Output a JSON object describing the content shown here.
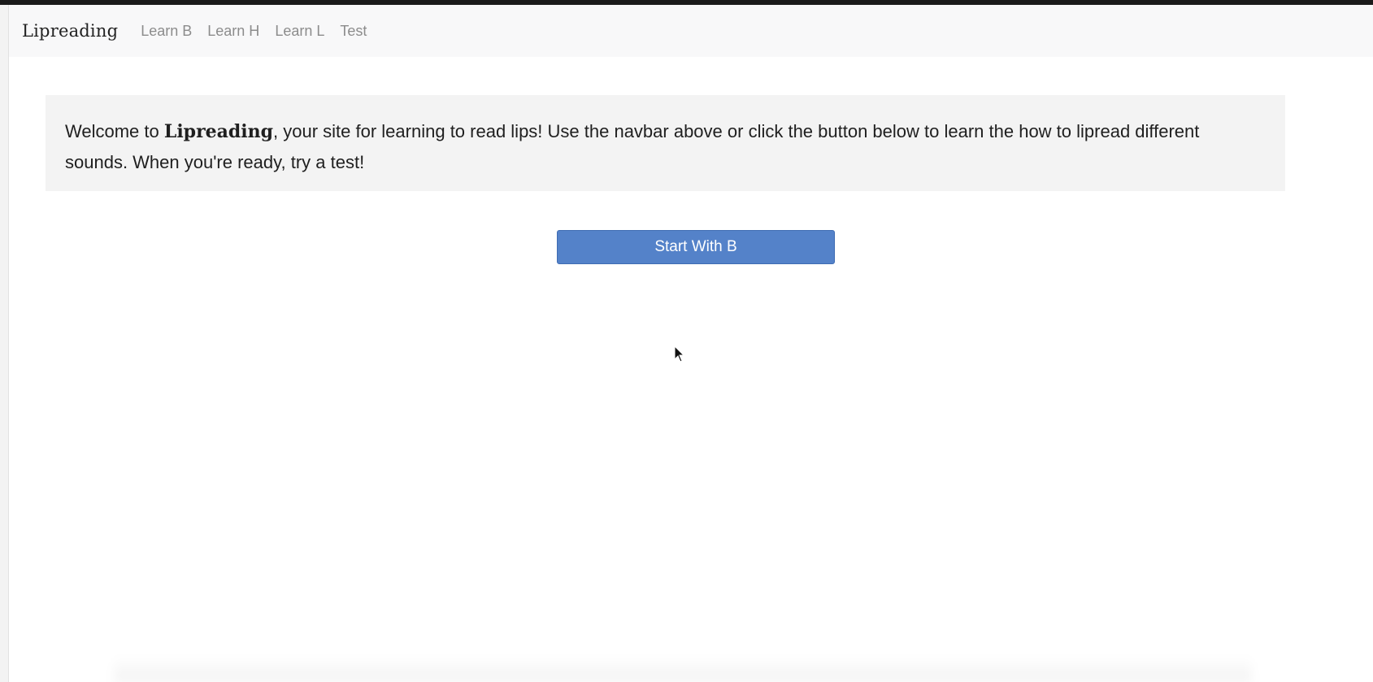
{
  "navbar": {
    "brand": "Lipreading",
    "links": [
      {
        "label": "Learn B"
      },
      {
        "label": "Learn H"
      },
      {
        "label": "Learn L"
      },
      {
        "label": "Test"
      }
    ]
  },
  "welcome": {
    "prefix": "Welcome to ",
    "brand": "Lipreading",
    "suffix": ", your site for learning to read lips! Use the navbar above or click the button below to learn the how to lipread different sounds. When you're ready, try a test!"
  },
  "start_button": {
    "label": "Start With B"
  },
  "colors": {
    "button": "#5482c9",
    "navbar_bg": "#f8f8f9",
    "welcome_bg": "#f3f3f3"
  }
}
